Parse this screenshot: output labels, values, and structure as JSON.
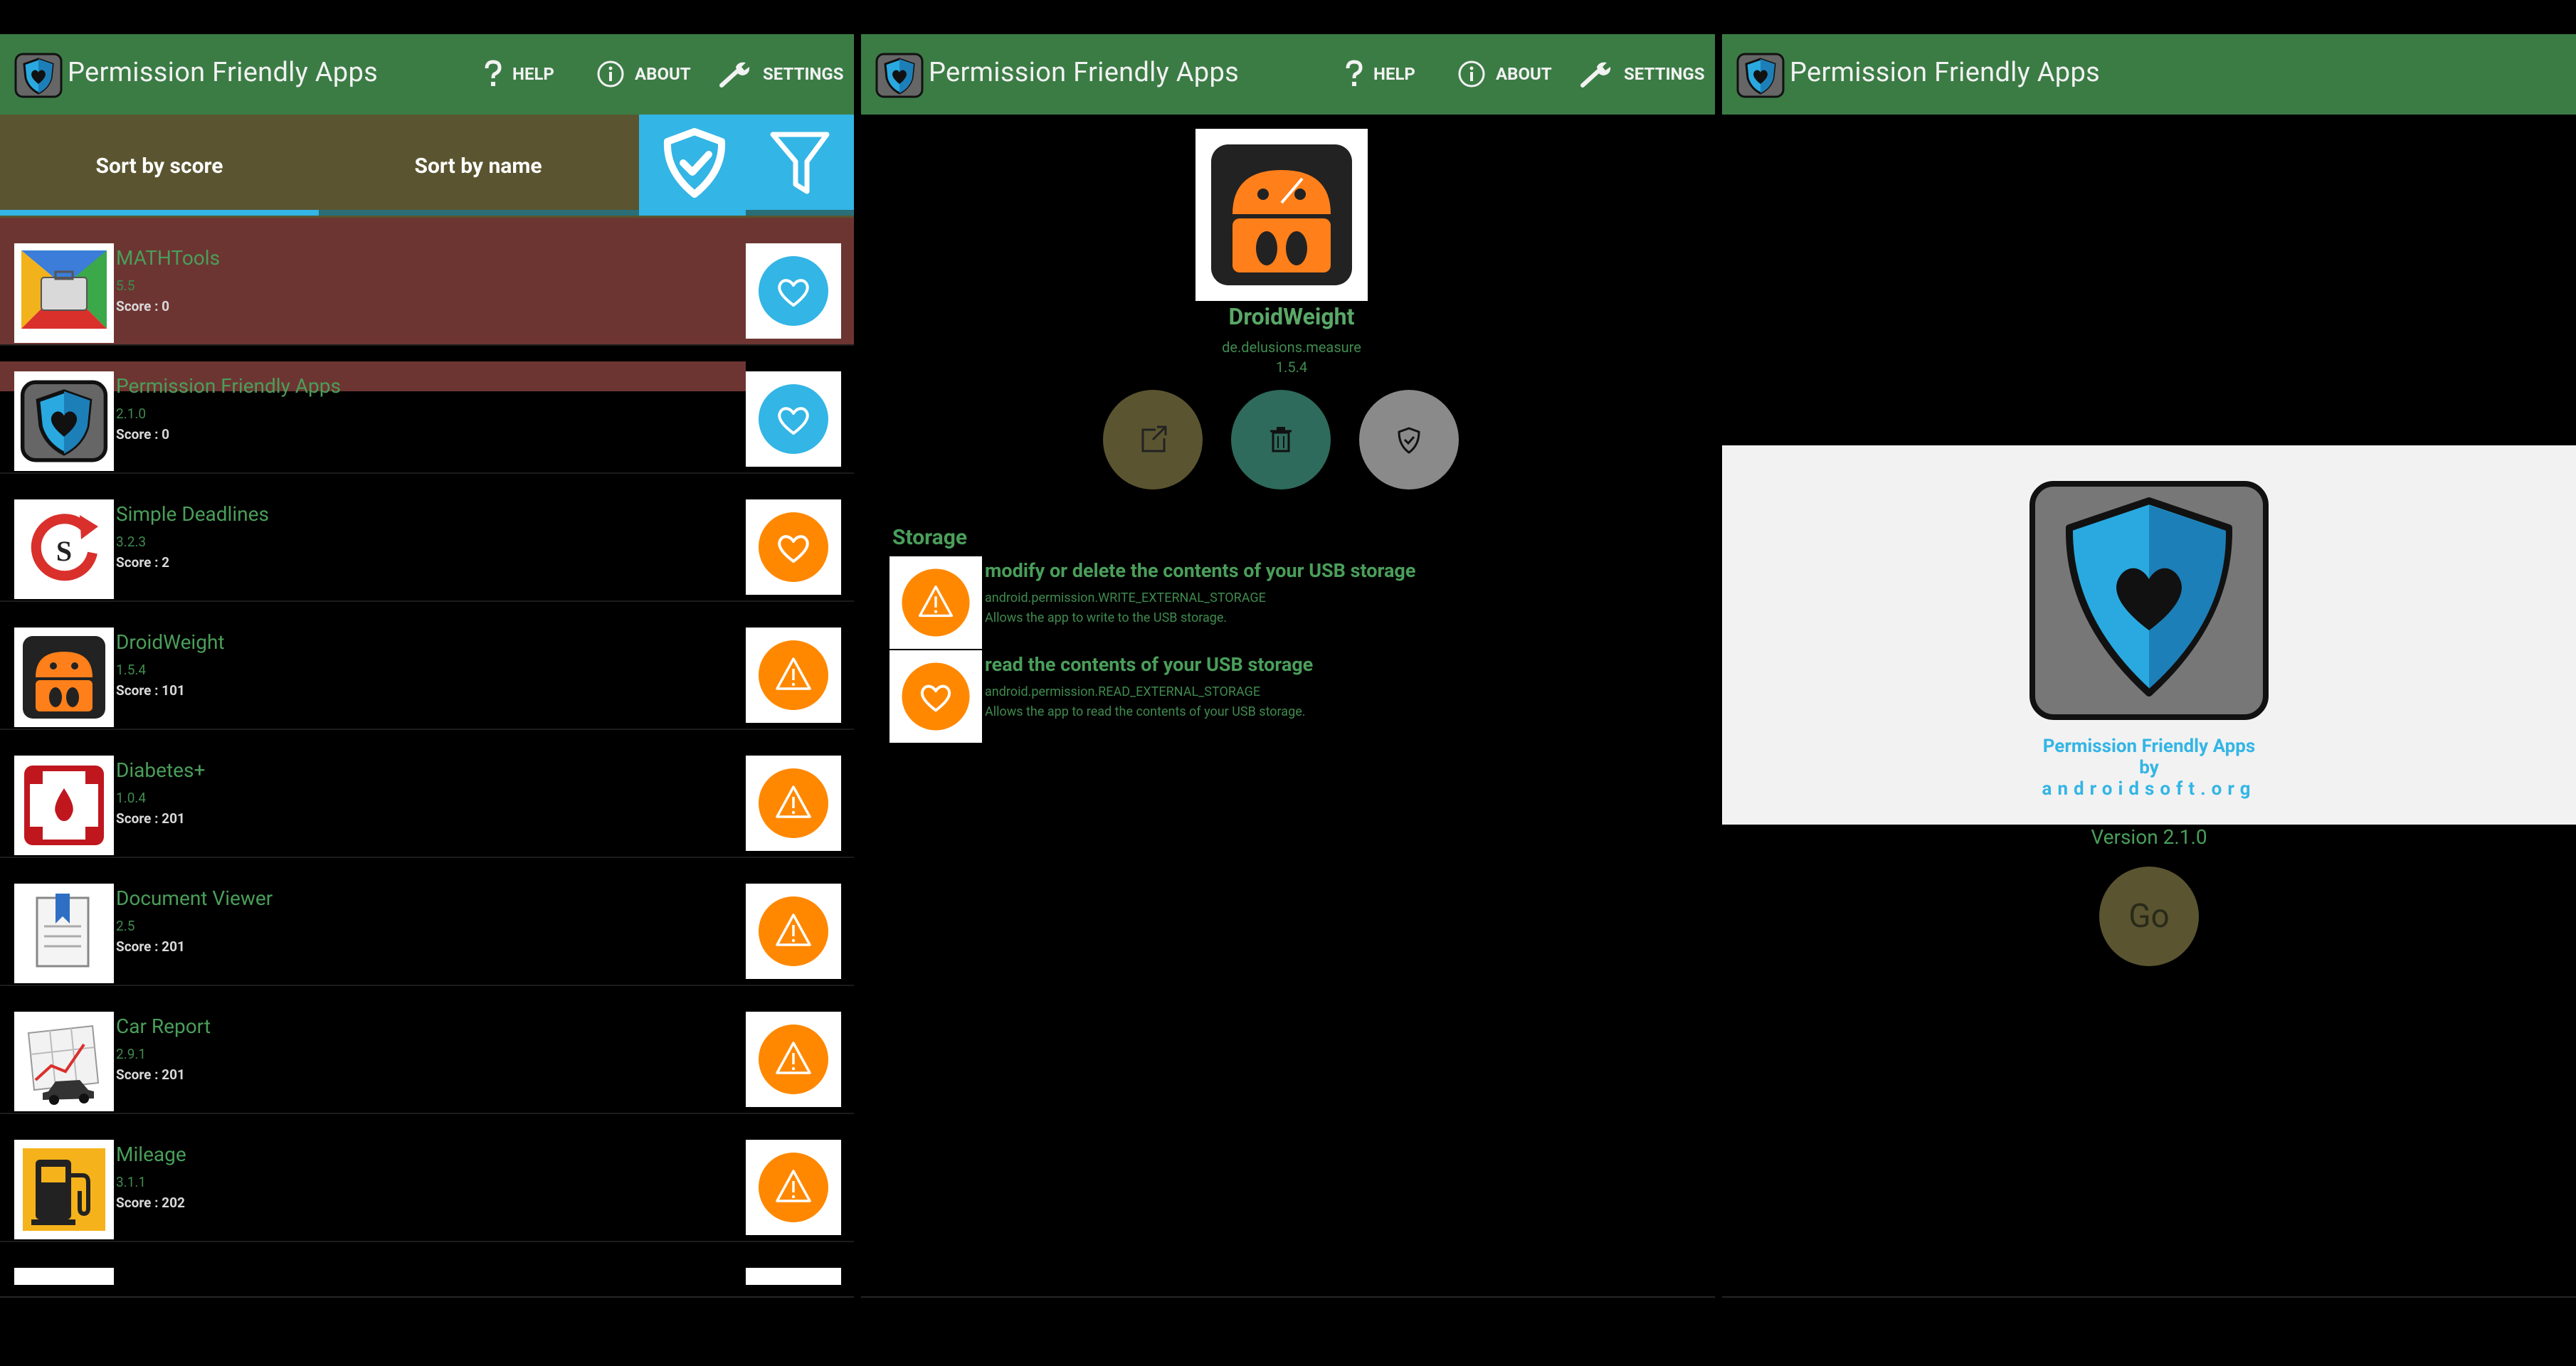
{
  "app": {
    "title": "Permission Friendly Apps",
    "actions": {
      "help": "HELP",
      "about": "ABOUT",
      "settings": "SETTINGS"
    }
  },
  "colors": {
    "actionbar": "#3b7c45",
    "accent": "#33b5e5",
    "warning": "#ff8800",
    "selected_row": "#6d3532"
  },
  "tabs": [
    {
      "label": "Sort by score"
    },
    {
      "label": "Sort by name"
    }
  ],
  "list": [
    {
      "name": "MATHTools",
      "version": "5.5",
      "score": "Score : 0",
      "icon": "toolbox-icon",
      "badge": "heart"
    },
    {
      "name": "Permission Friendly Apps",
      "version": "2.1.0",
      "score": "Score : 0",
      "icon": "shield-heart-icon",
      "badge": "heart"
    },
    {
      "name": "Simple Deadlines",
      "version": "3.2.3",
      "score": "Score : 2",
      "icon": "deadline-icon",
      "badge": "heart-orange"
    },
    {
      "name": "DroidWeight",
      "version": "1.5.4",
      "score": "Score : 101",
      "icon": "droid-scale-icon",
      "badge": "warning"
    },
    {
      "name": "Diabetes+",
      "version": "1.0.4",
      "score": "Score : 201",
      "icon": "blood-drop-icon",
      "badge": "warning"
    },
    {
      "name": "Document Viewer",
      "version": "2.5",
      "score": "Score : 201",
      "icon": "document-icon",
      "badge": "warning"
    },
    {
      "name": "Car Report",
      "version": "2.9.1",
      "score": "Score : 201",
      "icon": "car-chart-icon",
      "badge": "warning"
    },
    {
      "name": "Mileage",
      "version": "3.1.1",
      "score": "Score : 202",
      "icon": "fuel-pump-icon",
      "badge": "warning"
    }
  ],
  "detail": {
    "name": "DroidWeight",
    "package": "de.delusions.measure",
    "version": "1.5.4",
    "section": "Storage",
    "permissions": [
      {
        "title": "modify or delete the contents of your USB storage",
        "name": "android.permission.WRITE_EXTERNAL_STORAGE",
        "desc": "Allows the app to write to the USB storage.",
        "icon": "warning"
      },
      {
        "title": "read the contents of your USB storage",
        "name": "android.permission.READ_EXTERNAL_STORAGE",
        "desc": "Allows the app to read the contents of your USB storage.",
        "icon": "heart"
      }
    ]
  },
  "about": {
    "line1": "Permission Friendly Apps",
    "line2": "by",
    "line3": "androidsoft.org",
    "version": "Version 2.1.0",
    "go": "Go"
  }
}
